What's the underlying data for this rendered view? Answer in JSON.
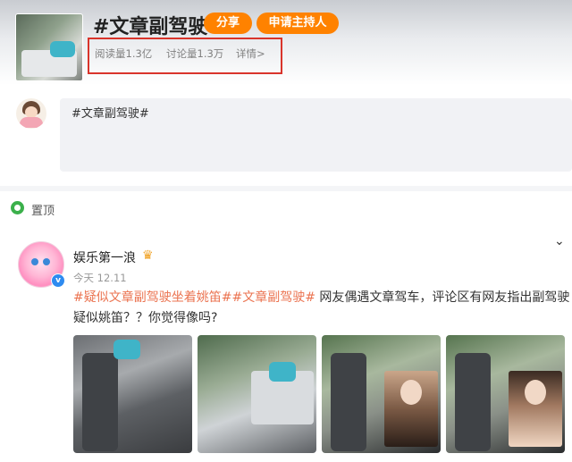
{
  "topic": {
    "title": "#文章副驾驶#",
    "share_label": "分享",
    "host_label": "申请主持人",
    "stats": {
      "read": "阅读量1.3亿",
      "discuss": "讨论量1.3万",
      "detail": "详情>"
    }
  },
  "composer": {
    "text": "#文章副驾驶#"
  },
  "section": {
    "pinned_label": "置顶"
  },
  "post": {
    "author_name": "娱乐第一浪",
    "vip_badge": "v",
    "time": "今天 12.11",
    "hashtag_1": "#疑似文章副驾驶坐着姚笛#",
    "hashtag_2": "#文章副驾驶#",
    "text_1": " 网友偶遇文章驾车，评论区有网友指出副驾驶",
    "text_2": "疑似姚笛？？你觉得像吗?",
    "image_count": 4
  },
  "icons": {
    "pin": "pin-icon",
    "chevron": "chevron-down-icon",
    "crown": "crown-icon"
  },
  "colors": {
    "accent": "#ff8200",
    "hashtag": "#eb7350",
    "highlight_box": "#d9342b",
    "pin": "#3bb04b",
    "vip": "#2e8bf0"
  }
}
